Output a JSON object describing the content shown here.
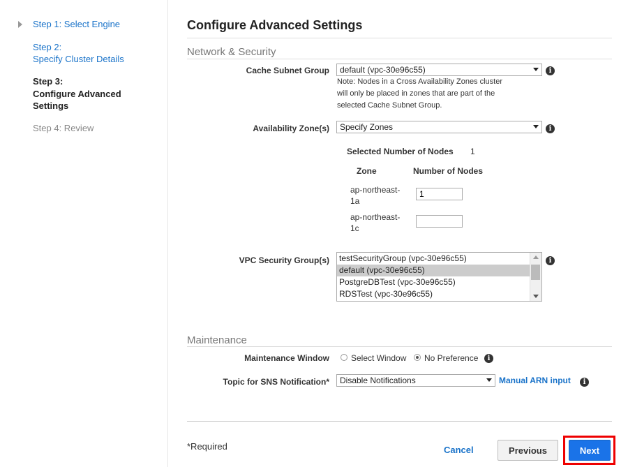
{
  "sidebar": {
    "steps": [
      {
        "label": "Step 1:   Select Engine"
      },
      {
        "label": "Step 2:",
        "sub": "Specify Cluster Details"
      },
      {
        "label": "Step 3:",
        "sub": "Configure Advanced",
        "sub2": "Settings"
      },
      {
        "label": "Step 4:   Review"
      }
    ]
  },
  "main": {
    "title": "Configure Advanced Settings",
    "network_section": "Network & Security",
    "cache_subnet": {
      "label": "Cache Subnet Group",
      "value": "default (vpc-30e96c55)",
      "note": [
        "Note: Nodes in a Cross Availability Zones cluster",
        "will only be placed in zones that are part of the",
        "selected Cache Subnet Group."
      ]
    },
    "availability_zone": {
      "label": "Availability Zone(s)",
      "value": "Specify Zones",
      "selected_nodes_label": "Selected Number of Nodes",
      "selected_nodes_value": "1",
      "col_zone": "Zone",
      "col_nodes": "Number of Nodes",
      "zones": [
        {
          "name1": "ap-northeast-",
          "name2": "1a",
          "nodes": "1"
        },
        {
          "name1": "ap-northeast-",
          "name2": "1c",
          "nodes": ""
        }
      ]
    },
    "vpc_security": {
      "label": "VPC Security Group(s)",
      "options": [
        "testSecurityGroup (vpc-30e96c55)",
        "default (vpc-30e96c55)",
        "PostgreDBTest (vpc-30e96c55)",
        "RDSTest (vpc-30e96c55)"
      ],
      "selected_index": 1
    },
    "maintenance_section": "Maintenance",
    "maintenance_window": {
      "label": "Maintenance Window",
      "option_select": "Select Window",
      "option_none": "No Preference",
      "selected": "No Preference"
    },
    "sns": {
      "label": "Topic for SNS Notification*",
      "value": "Disable Notifications",
      "manual_link": "Manual ARN input"
    },
    "footer": {
      "required": "*Required",
      "cancel": "Cancel",
      "previous": "Previous",
      "next": "Next"
    }
  },
  "colors": {
    "link": "#1a73c9",
    "primary_button": "#1a73e8",
    "highlight": "#e00000"
  },
  "icons": {
    "info": "info-icon",
    "collapse": "chevron-right-icon"
  }
}
